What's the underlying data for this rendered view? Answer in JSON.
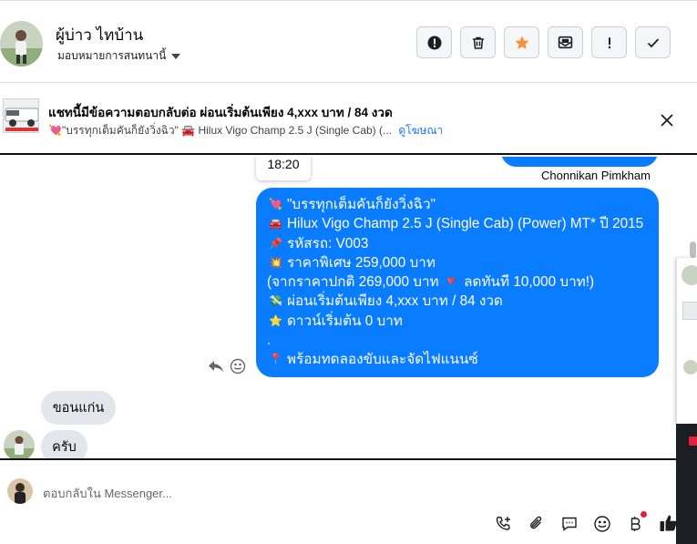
{
  "header": {
    "contact_name": "ผู้บ่าว ไทบ้าน",
    "assign_label": "มอบหมายการสนทนานี้",
    "actions": [
      {
        "name": "report-button",
        "icon": "alert-circle-icon"
      },
      {
        "name": "delete-button",
        "icon": "trash-icon"
      },
      {
        "name": "star-button",
        "icon": "star-icon"
      },
      {
        "name": "mark-unread-button",
        "icon": "envelope-icon"
      },
      {
        "name": "follow-up-button",
        "icon": "exclamation-icon"
      },
      {
        "name": "mark-done-button",
        "icon": "check-icon"
      }
    ]
  },
  "ad_banner": {
    "title": "แชทนี้มีข้อความตอบกลับต่อ ผ่อนเริ่มต้นเพียง 4,xxx บาท / 84 งวด",
    "subtitle": "💘\"บรรทุกเต็มคันก็ยังวิ่งฉิว\" 🚘 Hilux Vigo Champ 2.5 J (Single Cab) (...",
    "link_label": "ดูโฆษณา"
  },
  "chat": {
    "prev_sender": "Chonnikan Pimkham",
    "timestamp": "18:20",
    "outgoing_message": [
      {
        "emoji": "💘",
        "text": "\"บรรทุกเต็มคันก็ยังวิ่งฉิว\""
      },
      {
        "emoji": "🚘",
        "text": "Hilux Vigo Champ 2.5 J (Single Cab) (Power) MT* ปี 2015"
      },
      {
        "emoji": "📌",
        "text": "รหัสรถ: V003"
      },
      {
        "emoji": "💥",
        "text": "ราคาพิเศษ 259,000 บาท"
      },
      {
        "emoji": "",
        "text": "(จากราคาปกติ 269,000 บาท 🔻 ลดทันที 10,000 บาท!)"
      },
      {
        "emoji": "💸",
        "text": "ผ่อนเริ่มต้นเพียง 4,xxx บาท / 84 งวด"
      },
      {
        "emoji": "⭐",
        "text": "ดาวน์เริ่มต้น 0 บาท"
      },
      {
        "emoji": "",
        "text": "."
      },
      {
        "emoji": "📍",
        "text": "พร้อมทดลองขับและจัดไฟแนนซ์"
      }
    ],
    "incoming": [
      "ขอนแก่น",
      "ครับ"
    ]
  },
  "composer": {
    "placeholder": "ตอบกลับใน Messenger..."
  },
  "colors": {
    "outgoing_bubble": "#0a7cff",
    "incoming_bubble": "#e4e6eb",
    "link": "#1877f2",
    "star": "#f7923b",
    "notification_dot": "#e41e3f"
  }
}
